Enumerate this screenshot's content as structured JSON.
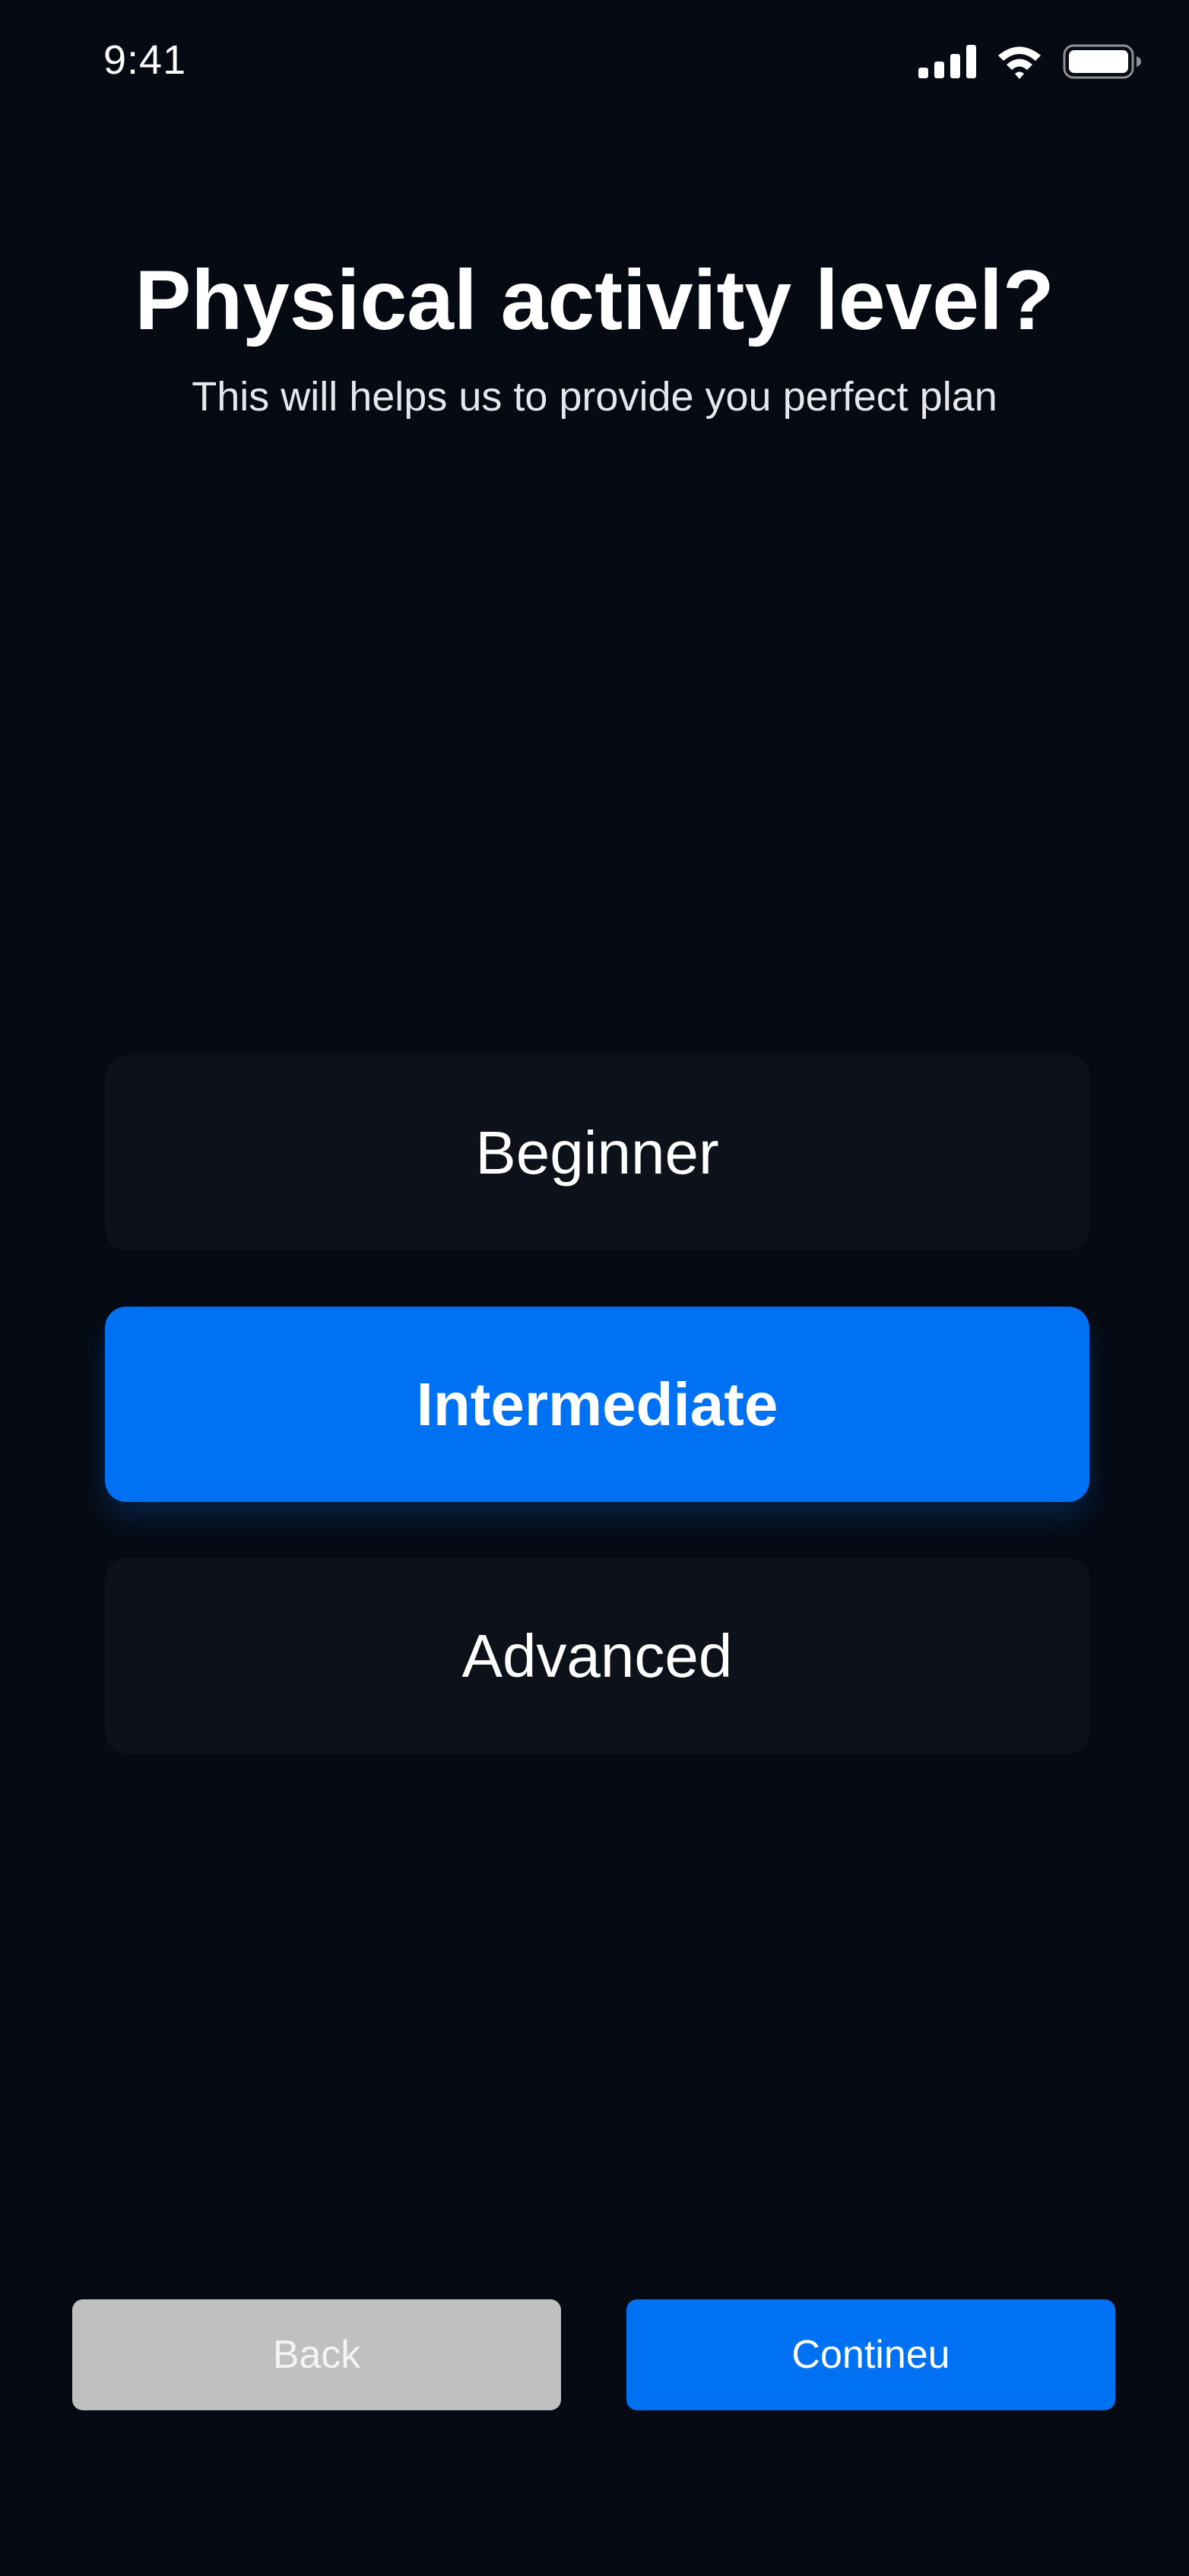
{
  "status_bar": {
    "time": "9:41",
    "icons": [
      "signal-icon",
      "wifi-icon",
      "battery-icon"
    ]
  },
  "header": {
    "title": "Physical activity level?",
    "subtitle": "This will helps us to provide you perfect plan"
  },
  "options": [
    {
      "label": "Beginner",
      "selected": false
    },
    {
      "label": "Intermediate",
      "selected": true
    },
    {
      "label": "Advanced",
      "selected": false
    }
  ],
  "footer": {
    "back_label": "Back",
    "continue_label": "Contineu"
  },
  "colors": {
    "background": "#060a12",
    "option_background": "#0c111a",
    "accent": "#0071f2",
    "back_button": "#bfc0c2",
    "text": "#ffffff"
  }
}
